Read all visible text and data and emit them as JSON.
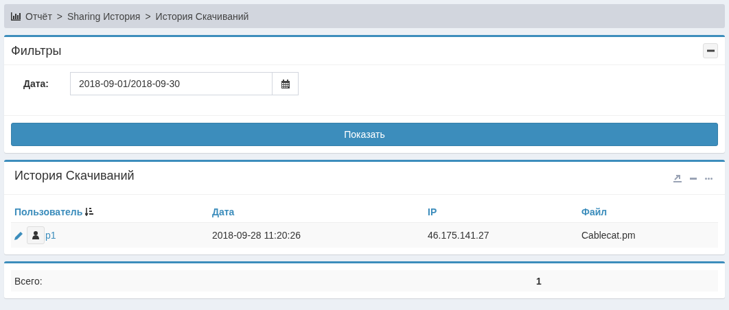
{
  "breadcrumb": [
    "Отчёт",
    "Sharing История",
    "История Скачиваний"
  ],
  "breadcrumb_separator": ">",
  "filters": {
    "title": "Фильтры",
    "date_label": "Дата:",
    "date_value": "2018-09-01/2018-09-30",
    "submit": "Показать"
  },
  "history": {
    "title": "История Скачиваний",
    "columns": [
      "Пользователь",
      "Дата",
      "IP",
      "Файл"
    ],
    "rows": [
      {
        "user": "p1",
        "date": "2018-09-28 11:20:26",
        "ip": "46.175.141.27",
        "file": "Cablecat.pm"
      }
    ]
  },
  "summary": {
    "label": "Всего:",
    "value": "1"
  }
}
